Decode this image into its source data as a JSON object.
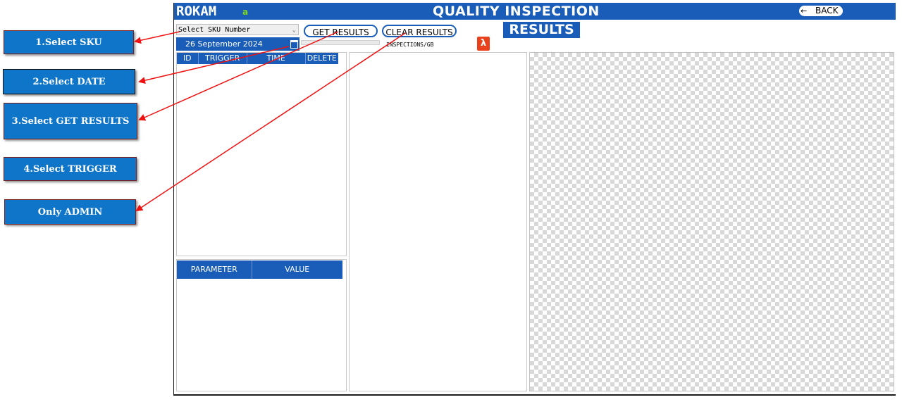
{
  "callouts": [
    {
      "label": "1.Select SKU"
    },
    {
      "label": "2.Select DATE"
    },
    {
      "label": "3.Select GET RESULTS"
    },
    {
      "label": "4.Select TRIGGER"
    },
    {
      "label": "Only ADMIN"
    }
  ],
  "app": {
    "logo": "ROKAM",
    "logo_sub": "a",
    "title": "QUALITY INSPECTION",
    "back_label": "BACK",
    "sku_select": {
      "value": "Select SKU Number"
    },
    "date_picker": {
      "value": "26 September 2024"
    },
    "get_results_label": "GET RESULTS",
    "clear_results_label": "CLEAR RESULTS",
    "inspections_label": "INSPECTIONS/GB",
    "results_heading": "RESULTS",
    "trigger_table": {
      "columns": [
        "ID",
        "TRIGGER",
        "TIME",
        "DELETE"
      ]
    },
    "param_table": {
      "columns": [
        "PARAMETER",
        "VALUE"
      ]
    }
  },
  "colors": {
    "primary": "#1a5db8",
    "callout": "#0f75c9",
    "arrow": "#ee1111",
    "pdf": "#e8411c"
  },
  "icons": [
    "back-arrow-icon",
    "calendar-icon",
    "pdf-icon",
    "chevron-down-icon"
  ]
}
